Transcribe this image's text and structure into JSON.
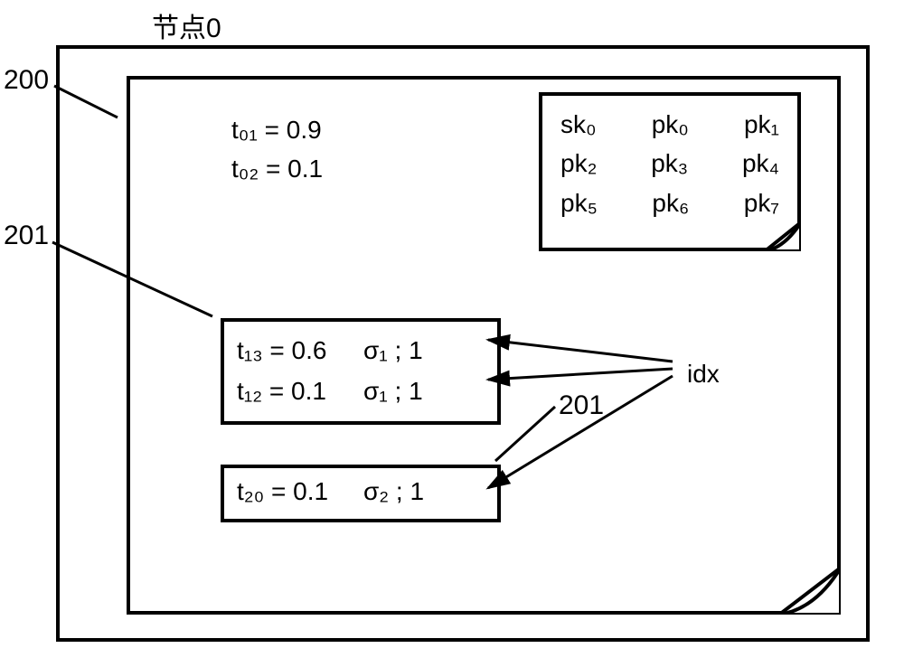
{
  "title": "节点0",
  "callouts": {
    "c200": "200",
    "c201a": "201",
    "c201b": "201"
  },
  "idx_label": "idx",
  "t_block": {
    "t01": "t₀₁ = 0.9",
    "t02": "t₀₂ = 0.1"
  },
  "keys": {
    "r1": {
      "a": "sk₀",
      "b": "pk₀",
      "c": "pk₁"
    },
    "r2": {
      "a": "pk₂",
      "b": "pk₃",
      "c": "pk₄"
    },
    "r3": {
      "a": "pk₅",
      "b": "pk₆",
      "c": "pk₇"
    }
  },
  "box_a": {
    "r1": {
      "l": "t₁₃ = 0.6",
      "r": "σ₁ ; 1"
    },
    "r2": {
      "l": "t₁₂ = 0.1",
      "r": "σ₁ ; 1"
    }
  },
  "box_b": {
    "r1": {
      "l": "t₂₀ = 0.1",
      "r": "σ₂ ; 1"
    }
  },
  "chart_data": {
    "type": "table",
    "node": 0,
    "own_trust": [
      {
        "from": 0,
        "to": 1,
        "value": 0.9
      },
      {
        "from": 0,
        "to": 2,
        "value": 0.1
      }
    ],
    "received_messages": [
      {
        "ref": 201,
        "entries": [
          {
            "from": 1,
            "to": 3,
            "value": 0.6,
            "sigma": 1,
            "idx": 1
          },
          {
            "from": 1,
            "to": 2,
            "value": 0.1,
            "sigma": 1,
            "idx": 1
          }
        ]
      },
      {
        "ref": 201,
        "entries": [
          {
            "from": 2,
            "to": 0,
            "value": 0.1,
            "sigma": 2,
            "idx": 1
          }
        ]
      }
    ],
    "keys": {
      "sk": [
        0
      ],
      "pk": [
        0,
        1,
        2,
        3,
        4,
        5,
        6,
        7
      ]
    },
    "refs": {
      "outer_box": 200,
      "msg_box": 201
    }
  }
}
